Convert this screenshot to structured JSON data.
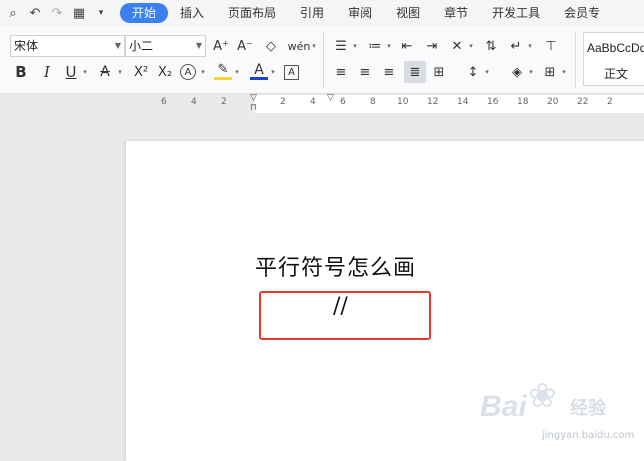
{
  "quick_access": {
    "icons": [
      "search-doc-icon",
      "undo-icon",
      "redo-icon",
      "print-icon",
      "more-dropdown-icon"
    ]
  },
  "menu": {
    "tabs": [
      {
        "label": "开始",
        "active": true
      },
      {
        "label": "插入",
        "active": false
      },
      {
        "label": "页面布局",
        "active": false
      },
      {
        "label": "引用",
        "active": false
      },
      {
        "label": "审阅",
        "active": false
      },
      {
        "label": "视图",
        "active": false
      },
      {
        "label": "章节",
        "active": false
      },
      {
        "label": "开发工具",
        "active": false
      },
      {
        "label": "会员专",
        "active": false
      }
    ]
  },
  "toolbar": {
    "font_family": "宋体",
    "font_size": "小二",
    "grow_font": "A⁺",
    "shrink_font": "A⁻",
    "pinyin": "wén",
    "bold": "B",
    "italic": "I",
    "underline": "U",
    "strikethrough": "A",
    "superscript": "X²",
    "subscript": "X₂",
    "text_effect": "A",
    "font_color": "A",
    "char_border": "A"
  },
  "styles": {
    "sample": "AaBbCcDd",
    "name": "正文"
  },
  "ruler": {
    "left_numbers": [
      "6",
      "4",
      "2"
    ],
    "right_numbers": [
      "2",
      "4",
      "6",
      "8",
      "10",
      "12",
      "14",
      "16",
      "18",
      "20",
      "22",
      "2"
    ]
  },
  "document": {
    "title": "平行符号怎么画",
    "symbol": "//"
  },
  "watermark": {
    "brand": "Bai",
    "brand_suffix": "经验",
    "url": "jingyan.baidu.com"
  },
  "colors": {
    "accent": "#3b7ff0",
    "highlight_border": "#e43a2f",
    "font_color_bar": "#1e3fd8",
    "highlight_color_bar": "#f5d33b"
  }
}
